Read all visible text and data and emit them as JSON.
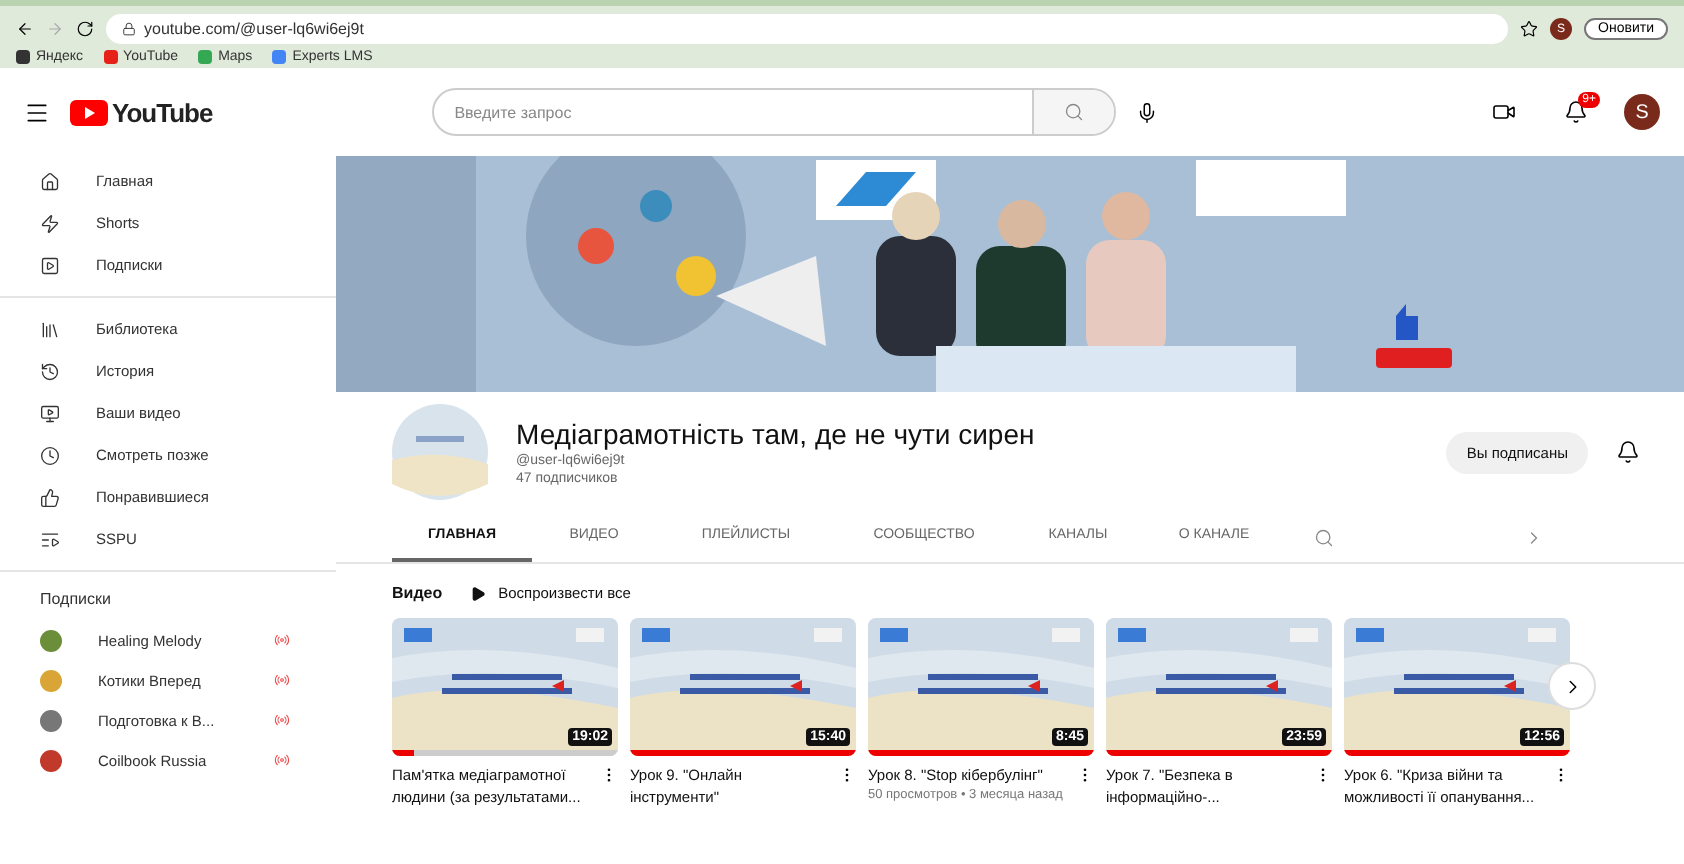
{
  "browser": {
    "url": "youtube.com/@user-lq6wi6ej9t",
    "profile": "S",
    "update_button": "Оновити",
    "bookmarks": [
      {
        "label": "Яндекс",
        "color": "#333333"
      },
      {
        "label": "YouTube",
        "color": "#e62117"
      },
      {
        "label": "Maps",
        "color": "#34a853"
      },
      {
        "label": "Experts LMS",
        "color": "#4285f4"
      }
    ]
  },
  "header": {
    "logo": "YouTube",
    "search": {
      "placeholder": "Введите запрос"
    },
    "notification_count": "9+",
    "avatar": "S"
  },
  "sidebar": {
    "sections": [
      {
        "items": [
          {
            "label": "Главная",
            "selected": false
          },
          {
            "label": "Shorts",
            "selected": false
          },
          {
            "label": "Подписки",
            "selected": false
          }
        ]
      },
      {
        "items": [
          {
            "label": "Библиотека",
            "selected": false
          },
          {
            "label": "История",
            "selected": false
          },
          {
            "label": "Ваши видео",
            "selected": false
          },
          {
            "label": "Смотреть позже",
            "selected": false
          },
          {
            "label": "Понравившиеся",
            "selected": false
          },
          {
            "label": "SSPU",
            "selected": false
          }
        ]
      }
    ],
    "subscriptions": {
      "title": "Подписки",
      "items": [
        {
          "name": "Healing Melody",
          "color": "#6b8e3a",
          "live": true
        },
        {
          "name": "Котики Вперед",
          "color": "#d9a536",
          "live": true
        },
        {
          "name": "Подготовка к В...",
          "color": "#777777",
          "live": true
        },
        {
          "name": "Coilbook Russia",
          "color": "#c0392b",
          "live": true
        }
      ]
    }
  },
  "channel": {
    "name": "Медіаграмотність там, де не чути сирен",
    "handle": "@user-lq6wi6ej9t",
    "subscribers": "47 подписчиков",
    "subscribe_button": "Вы подписаны",
    "tabs": [
      {
        "label": "ГЛАВНАЯ",
        "selected": true
      },
      {
        "label": "ВИДЕО",
        "selected": false
      },
      {
        "label": "ПЛЕЙЛИСТЫ",
        "selected": false
      },
      {
        "label": "СООБЩЕСТВО",
        "selected": false
      },
      {
        "label": "КАНАЛЫ",
        "selected": false
      },
      {
        "label": "О КАНАЛЕ",
        "selected": false
      }
    ]
  },
  "videos_section": {
    "title": "Видео",
    "play_all": "Воспроизвести все",
    "videos": [
      {
        "duration": "19:02",
        "level": 0.1,
        "title": "Пам'ятка медіаграмотної людини (за результатами..."
      },
      {
        "duration": "15:40",
        "level": 1,
        "title": "Урок 9. \"Онлайн інструменти\""
      },
      {
        "duration": "8:45",
        "level": 1,
        "title": "Урок 8. \"Stop кібербулінг\"",
        "meta": "50 просмотров • 3 месяца назад"
      },
      {
        "duration": "23:59",
        "level": 1,
        "title": "Урок 7. \"Безпека в інформаційно-..."
      },
      {
        "duration": "12:56",
        "level": 1,
        "title": "Урок 6. \"Криза війни та можливості її опанування..."
      }
    ]
  }
}
